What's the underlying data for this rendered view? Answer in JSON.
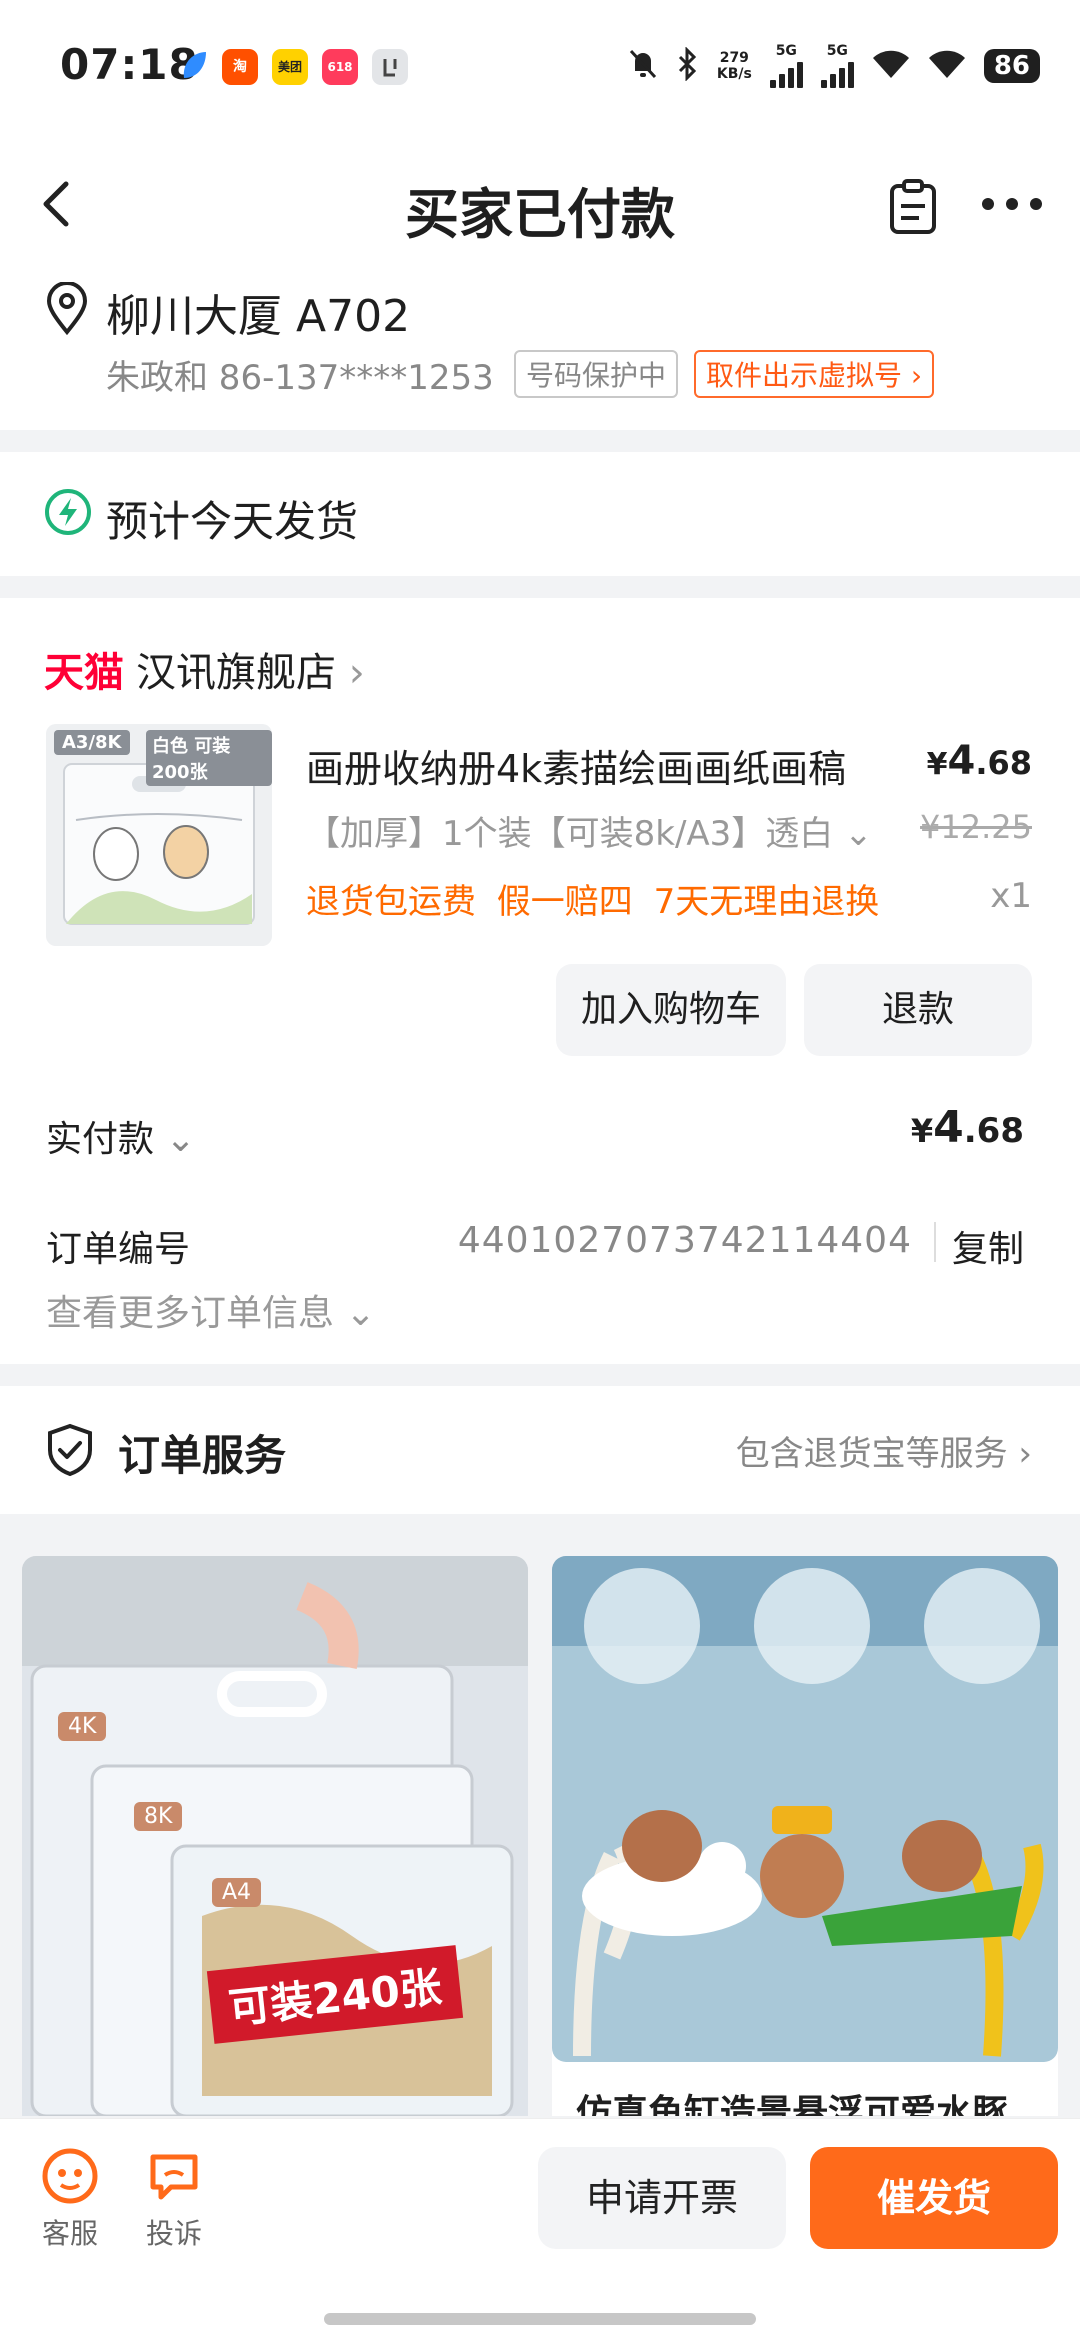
{
  "status_bar": {
    "time": "07:18",
    "net_speed_value": "279",
    "net_speed_unit": "KB/s",
    "sim1": "5G",
    "sim2": "5G",
    "battery": "86",
    "apps": [
      {
        "icon": "leaf-icon",
        "color": "#2f8cff"
      },
      {
        "icon": "taobao-icon",
        "color": "#ff5000",
        "text": "淘"
      },
      {
        "icon": "meituan-icon",
        "color": "#ffd100",
        "text": "美团"
      },
      {
        "icon": "app-618-icon",
        "color": "#ff3b5c",
        "text": "618"
      },
      {
        "icon": "gray-app-icon",
        "color": "#d7d9dc"
      }
    ]
  },
  "header": {
    "title": "买家已付款"
  },
  "address": {
    "line": "柳川大厦 A702",
    "contact": "朱政和 86-137****1253",
    "protect_tag": "号码保护中",
    "virtual_number_link": "取件出示虚拟号"
  },
  "shipping": {
    "text": "预计今天发货"
  },
  "order": {
    "platform": "天猫",
    "store": "汉讯旗舰店",
    "thumb_label1": "A3/8K",
    "thumb_label2": "白色 可装200张",
    "product_name": "画册收纳册4k素描绘画画纸画稿",
    "price_symbol": "¥",
    "price_int": "4",
    "price_dec": ".68",
    "sku": "【加厚】1个装【可装8k/A3】透白",
    "original_price": "¥12.25",
    "service_tags": "退货包运费 假一赔四 7天无理由退换",
    "quantity": "x1",
    "add_cart_button": "加入购物车",
    "refund_button": "退款",
    "paid_label": "实付款",
    "paid_symbol": "¥",
    "paid_int": "4",
    "paid_dec": ".68",
    "order_no_label": "订单编号",
    "order_no": "4401027073742114404",
    "copy_button": "复制",
    "more_info": "查看更多订单信息"
  },
  "service": {
    "title": "订单服务",
    "detail": "包含退货宝等服务"
  },
  "recommendations": [
    {
      "badges": [
        "4K",
        "8K",
        "A4"
      ],
      "banner": "可装240张"
    },
    {
      "title": "仿真鱼缸造景悬浮可爱水豚"
    }
  ],
  "bottom_bar": {
    "customer_service": "客服",
    "complaint": "投诉",
    "invoice_button": "申请开票",
    "urge_button": "催发货",
    "accent_color": "#ff6a1a"
  }
}
